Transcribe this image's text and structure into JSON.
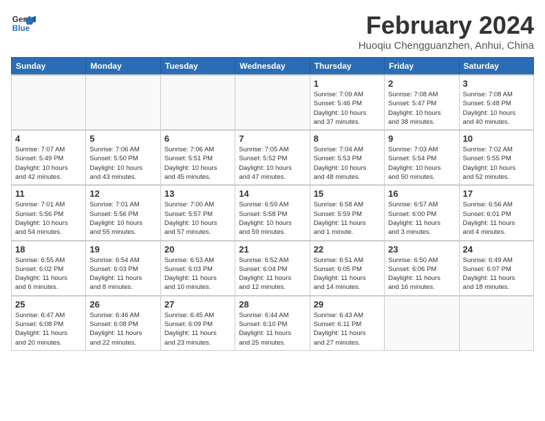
{
  "header": {
    "logo_line1": "General",
    "logo_line2": "Blue",
    "month_title": "February 2024",
    "subtitle": "Huoqiu Chengguanzhen, Anhui, China"
  },
  "days_of_week": [
    "Sunday",
    "Monday",
    "Tuesday",
    "Wednesday",
    "Thursday",
    "Friday",
    "Saturday"
  ],
  "weeks": [
    [
      {
        "day": "",
        "info": ""
      },
      {
        "day": "",
        "info": ""
      },
      {
        "day": "",
        "info": ""
      },
      {
        "day": "",
        "info": ""
      },
      {
        "day": "1",
        "info": "Sunrise: 7:09 AM\nSunset: 5:46 PM\nDaylight: 10 hours\nand 37 minutes."
      },
      {
        "day": "2",
        "info": "Sunrise: 7:08 AM\nSunset: 5:47 PM\nDaylight: 10 hours\nand 38 minutes."
      },
      {
        "day": "3",
        "info": "Sunrise: 7:08 AM\nSunset: 5:48 PM\nDaylight: 10 hours\nand 40 minutes."
      }
    ],
    [
      {
        "day": "4",
        "info": "Sunrise: 7:07 AM\nSunset: 5:49 PM\nDaylight: 10 hours\nand 42 minutes."
      },
      {
        "day": "5",
        "info": "Sunrise: 7:06 AM\nSunset: 5:50 PM\nDaylight: 10 hours\nand 43 minutes."
      },
      {
        "day": "6",
        "info": "Sunrise: 7:06 AM\nSunset: 5:51 PM\nDaylight: 10 hours\nand 45 minutes."
      },
      {
        "day": "7",
        "info": "Sunrise: 7:05 AM\nSunset: 5:52 PM\nDaylight: 10 hours\nand 47 minutes."
      },
      {
        "day": "8",
        "info": "Sunrise: 7:04 AM\nSunset: 5:53 PM\nDaylight: 10 hours\nand 48 minutes."
      },
      {
        "day": "9",
        "info": "Sunrise: 7:03 AM\nSunset: 5:54 PM\nDaylight: 10 hours\nand 50 minutes."
      },
      {
        "day": "10",
        "info": "Sunrise: 7:02 AM\nSunset: 5:55 PM\nDaylight: 10 hours\nand 52 minutes."
      }
    ],
    [
      {
        "day": "11",
        "info": "Sunrise: 7:01 AM\nSunset: 5:56 PM\nDaylight: 10 hours\nand 54 minutes."
      },
      {
        "day": "12",
        "info": "Sunrise: 7:01 AM\nSunset: 5:56 PM\nDaylight: 10 hours\nand 55 minutes."
      },
      {
        "day": "13",
        "info": "Sunrise: 7:00 AM\nSunset: 5:57 PM\nDaylight: 10 hours\nand 57 minutes."
      },
      {
        "day": "14",
        "info": "Sunrise: 6:59 AM\nSunset: 5:58 PM\nDaylight: 10 hours\nand 59 minutes."
      },
      {
        "day": "15",
        "info": "Sunrise: 6:58 AM\nSunset: 5:59 PM\nDaylight: 11 hours\nand 1 minute."
      },
      {
        "day": "16",
        "info": "Sunrise: 6:57 AM\nSunset: 6:00 PM\nDaylight: 11 hours\nand 3 minutes."
      },
      {
        "day": "17",
        "info": "Sunrise: 6:56 AM\nSunset: 6:01 PM\nDaylight: 11 hours\nand 4 minutes."
      }
    ],
    [
      {
        "day": "18",
        "info": "Sunrise: 6:55 AM\nSunset: 6:02 PM\nDaylight: 11 hours\nand 6 minutes."
      },
      {
        "day": "19",
        "info": "Sunrise: 6:54 AM\nSunset: 6:03 PM\nDaylight: 11 hours\nand 8 minutes."
      },
      {
        "day": "20",
        "info": "Sunrise: 6:53 AM\nSunset: 6:03 PM\nDaylight: 11 hours\nand 10 minutes."
      },
      {
        "day": "21",
        "info": "Sunrise: 6:52 AM\nSunset: 6:04 PM\nDaylight: 11 hours\nand 12 minutes."
      },
      {
        "day": "22",
        "info": "Sunrise: 6:51 AM\nSunset: 6:05 PM\nDaylight: 11 hours\nand 14 minutes."
      },
      {
        "day": "23",
        "info": "Sunrise: 6:50 AM\nSunset: 6:06 PM\nDaylight: 11 hours\nand 16 minutes."
      },
      {
        "day": "24",
        "info": "Sunrise: 6:49 AM\nSunset: 6:07 PM\nDaylight: 11 hours\nand 18 minutes."
      }
    ],
    [
      {
        "day": "25",
        "info": "Sunrise: 6:47 AM\nSunset: 6:08 PM\nDaylight: 11 hours\nand 20 minutes."
      },
      {
        "day": "26",
        "info": "Sunrise: 6:46 AM\nSunset: 6:08 PM\nDaylight: 11 hours\nand 22 minutes."
      },
      {
        "day": "27",
        "info": "Sunrise: 6:45 AM\nSunset: 6:09 PM\nDaylight: 11 hours\nand 23 minutes."
      },
      {
        "day": "28",
        "info": "Sunrise: 6:44 AM\nSunset: 6:10 PM\nDaylight: 11 hours\nand 25 minutes."
      },
      {
        "day": "29",
        "info": "Sunrise: 6:43 AM\nSunset: 6:11 PM\nDaylight: 11 hours\nand 27 minutes."
      },
      {
        "day": "",
        "info": ""
      },
      {
        "day": "",
        "info": ""
      }
    ]
  ]
}
